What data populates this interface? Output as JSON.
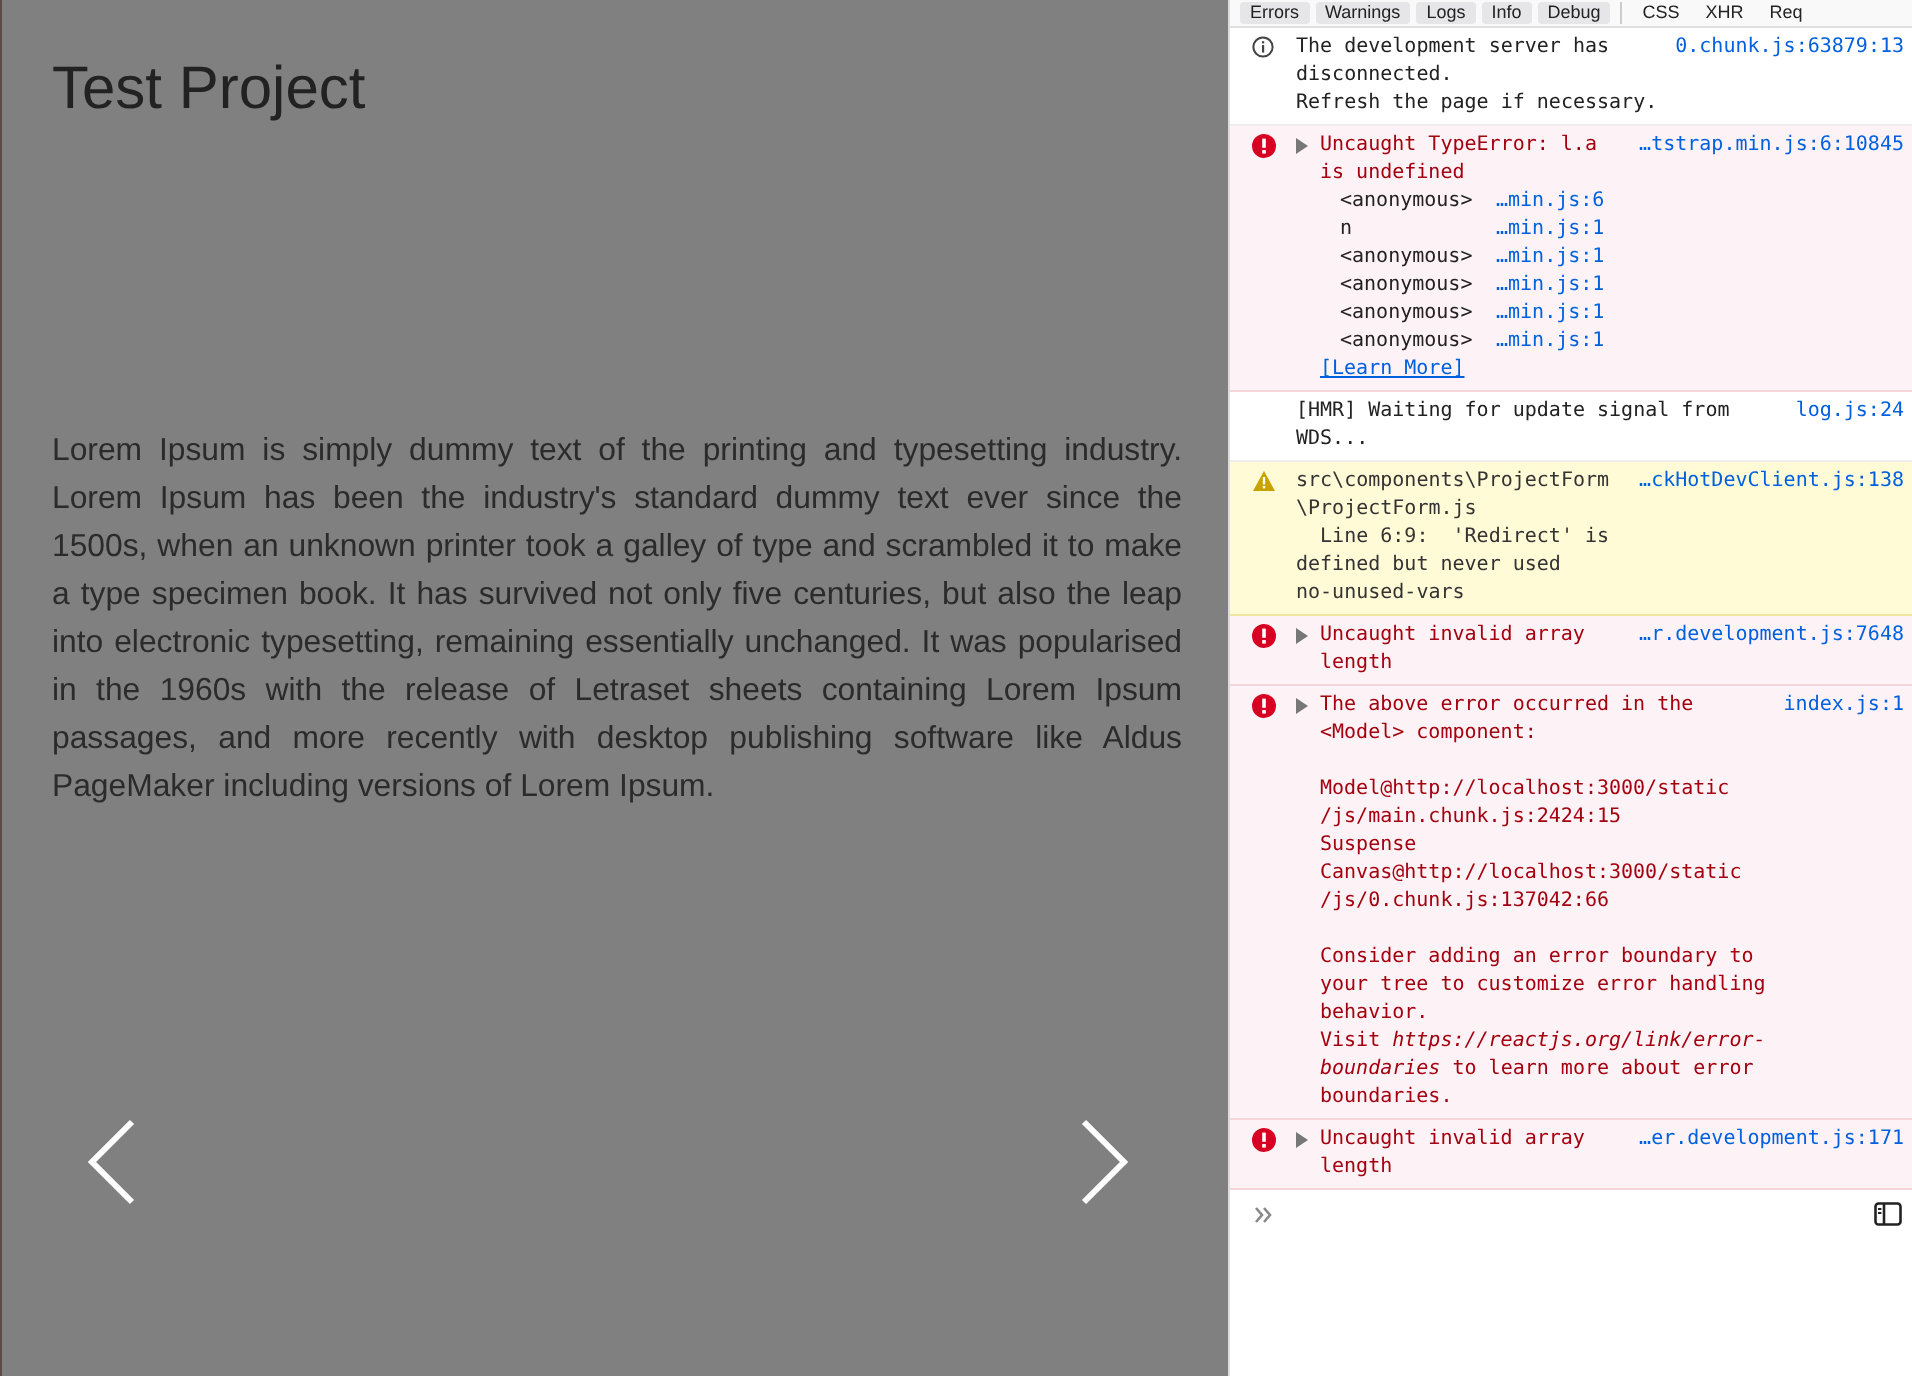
{
  "page": {
    "title": "Test Project",
    "paragraph": "Lorem Ipsum is simply dummy text of the printing and typesetting industry. Lorem Ipsum has been the industry's standard dummy text ever since the 1500s, when an unknown printer took a galley of type and scrambled it to make a type specimen book. It has survived not only five centuries, but also the leap into electronic typesetting, remaining essentially unchanged. It was popularised in the 1960s with the release of Letraset sheets containing Lorem Ipsum passages, and more recently with desktop publishing software like Aldus PageMaker including versions of Lorem Ipsum."
  },
  "console": {
    "filters": [
      {
        "label": "Errors",
        "kind": "level"
      },
      {
        "label": "Warnings",
        "kind": "level"
      },
      {
        "label": "Logs",
        "kind": "level"
      },
      {
        "label": "Info",
        "kind": "level"
      },
      {
        "label": "Debug",
        "kind": "level"
      },
      {
        "label": "CSS",
        "kind": "type"
      },
      {
        "label": "XHR",
        "kind": "type"
      },
      {
        "label": "Req",
        "kind": "type"
      }
    ],
    "messages": [
      {
        "kind": "info",
        "text": "The development server has\ndisconnected.\nRefresh the page if necessary.",
        "source": "0.chunk.js:63879:13"
      },
      {
        "kind": "error",
        "expandable": true,
        "text": "Uncaught TypeError: l.a\nis undefined",
        "source": "…tstrap.min.js:6:10845",
        "stack": [
          {
            "function": "<anonymous>",
            "location": "…min.js:6"
          },
          {
            "function": "n",
            "location": "…min.js:1"
          },
          {
            "function": "<anonymous>",
            "location": "…min.js:1"
          },
          {
            "function": "<anonymous>",
            "location": "…min.js:1"
          },
          {
            "function": "<anonymous>",
            "location": "…min.js:1"
          },
          {
            "function": "<anonymous>",
            "location": "…min.js:1"
          }
        ],
        "learn_more": "[Learn More]"
      },
      {
        "kind": "log",
        "text": "[HMR] Waiting for update signal from\nWDS...",
        "source": "log.js:24"
      },
      {
        "kind": "warning",
        "text": "src\\components\\ProjectForm\n\\ProjectForm.js\n  Line 6:9:  'Redirect' is\ndefined but never used\nno-unused-vars",
        "source": "…ckHotDevClient.js:138"
      },
      {
        "kind": "error",
        "expandable": true,
        "text": "Uncaught invalid array\nlength",
        "source": "…r.development.js:7648"
      },
      {
        "kind": "error",
        "expandable": true,
        "text": "The above error occurred in the\n<Model> component:\n\nModel@http://localhost:3000/static\n/js/main.chunk.js:2424:15\nSuspense\nCanvas@http://localhost:3000/static\n/js/0.chunk.js:137042:66\n\nConsider adding an error boundary to\nyour tree to customize error handling\nbehavior.\nVisit *https://reactjs.org/link/error-\nboundaries* to learn more about error\nboundaries.",
        "source": "index.js:1"
      },
      {
        "kind": "error",
        "expandable": true,
        "text": "Uncaught invalid array\nlength",
        "source": "…er.development.js:171"
      }
    ]
  }
}
